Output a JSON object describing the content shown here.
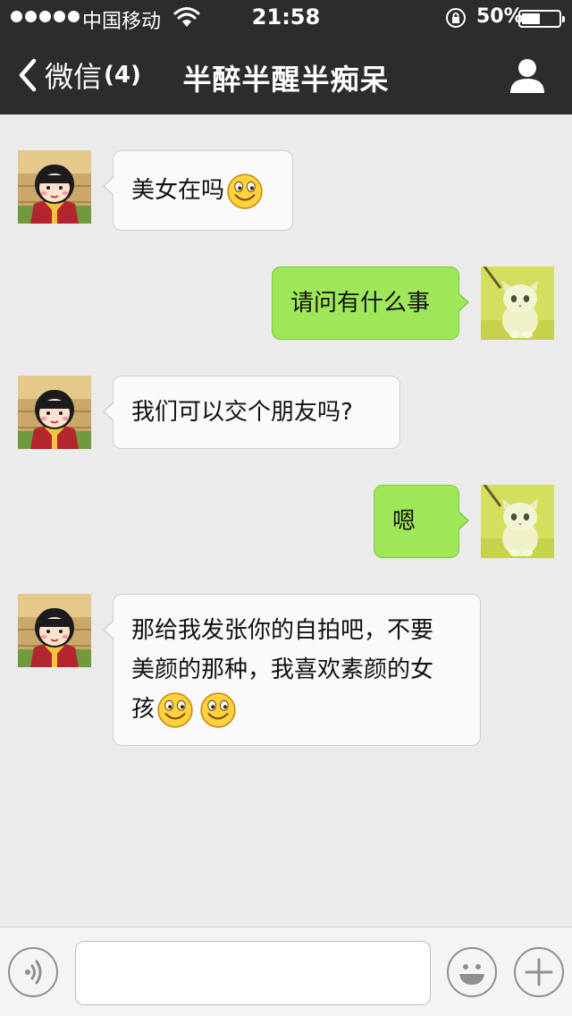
{
  "status_bar": {
    "carrier": "中国移动",
    "time": "21:58",
    "battery_percent": "50%",
    "battery_level": 0.5,
    "signal_bars": 5
  },
  "nav": {
    "back_label": "微信",
    "back_badge": "(4)",
    "title": "半醉半醒半痴呆"
  },
  "messages": [
    {
      "side": "in",
      "text": "美女在吗",
      "emoji_count": 1
    },
    {
      "side": "out",
      "text": "请问有什么事",
      "emoji_count": 0
    },
    {
      "side": "in",
      "text": "我们可以交个朋友吗?",
      "emoji_count": 0
    },
    {
      "side": "out",
      "text": "嗯",
      "emoji_count": 0
    },
    {
      "side": "in",
      "text_lines": [
        "那给我发张你的自拍吧，不要",
        "美颜的那种，我喜欢素颜的女",
        "孩"
      ],
      "emoji_count": 2
    }
  ],
  "input": {
    "placeholder": "",
    "value": ""
  },
  "colors": {
    "nav_bg": "#2c2c2e",
    "chat_bg": "#ebebeb",
    "incoming_bubble": "#fafafa",
    "outgoing_bubble": "#9fe758",
    "input_bar": "#f4f4f4"
  },
  "icons": {
    "back": "chevron-left-icon",
    "profile": "person-icon",
    "voice": "voice-icon",
    "emoji": "smiley-icon",
    "plus": "plus-icon",
    "wifi": "wifi-icon",
    "lock": "rotation-lock-icon"
  }
}
